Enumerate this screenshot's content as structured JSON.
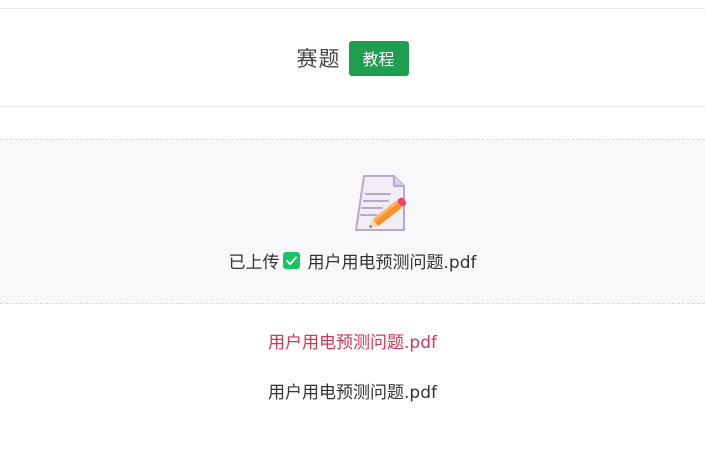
{
  "header": {
    "title": "赛题",
    "tutorial_button_label": "教程"
  },
  "upload": {
    "icon": "document-pencil-icon",
    "status_prefix": "已上传",
    "status_icon": "check-icon",
    "file_name": "用户用电预测问题.pdf"
  },
  "files": {
    "link_name": "用户用电预测问题.pdf",
    "plain_name": "用户用电预测问题.pdf"
  },
  "colors": {
    "accent_green": "#1e9e4f",
    "check_green": "#19c463",
    "link_red": "#d43753",
    "upload_bg": "#f8f8fb"
  }
}
